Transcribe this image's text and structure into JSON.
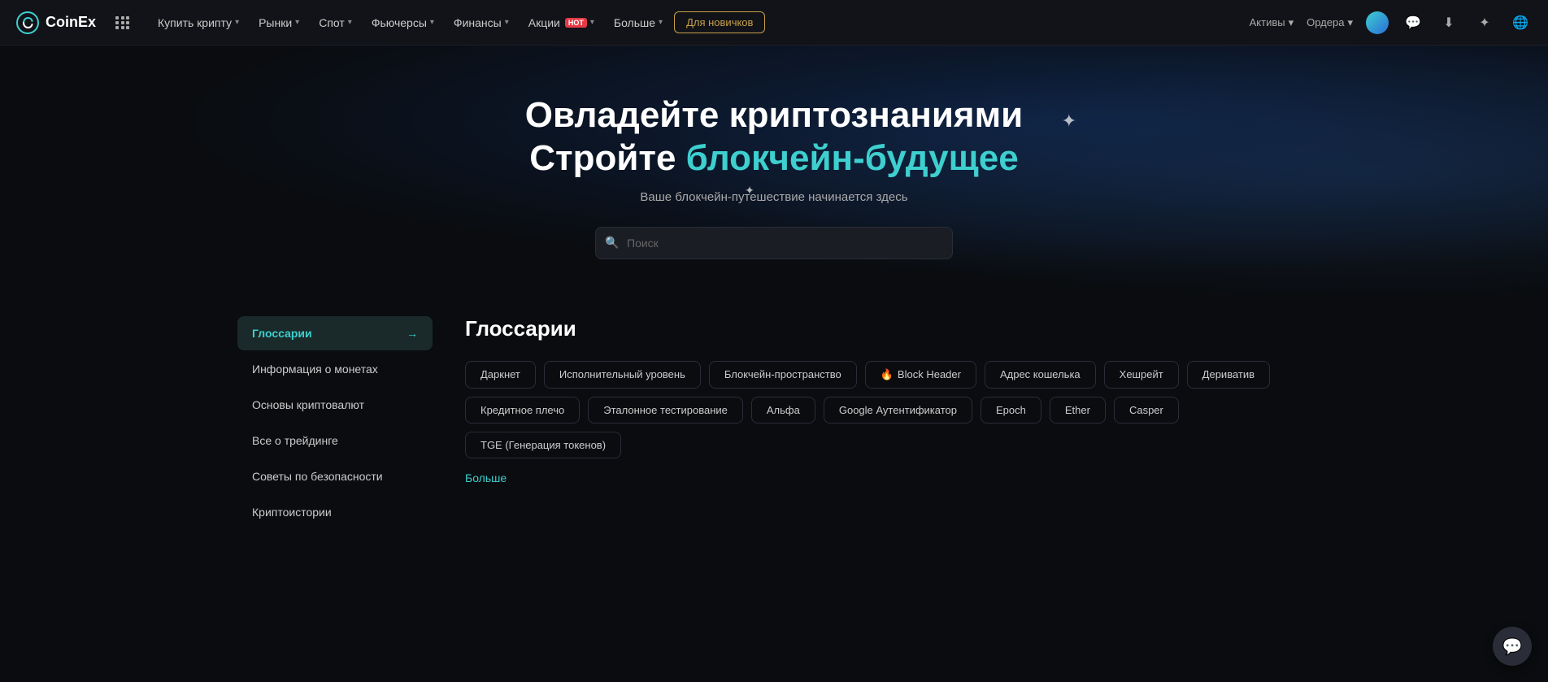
{
  "navbar": {
    "logo_text": "CoinEx",
    "items": [
      {
        "label": "Купить крипту",
        "has_dropdown": true
      },
      {
        "label": "Рынки",
        "has_dropdown": true
      },
      {
        "label": "Спот",
        "has_dropdown": true
      },
      {
        "label": "Фьючерсы",
        "has_dropdown": true
      },
      {
        "label": "Финансы",
        "has_dropdown": true
      },
      {
        "label": "Акции",
        "has_dropdown": true,
        "badge": "HOT"
      },
      {
        "label": "Больше",
        "has_dropdown": true
      }
    ],
    "novice_btn": "Для новичков",
    "right_items": [
      {
        "label": "Активы",
        "has_dropdown": true
      },
      {
        "label": "Ордера",
        "has_dropdown": true
      }
    ]
  },
  "hero": {
    "title_line1": "Овладейте криптознаниями",
    "title_line2_prefix": "Стройте ",
    "title_line2_accent": "блокчейн-будущее",
    "subtitle": "Ваше блокчейн-путешествие начинается здесь",
    "search_placeholder": "Поиск"
  },
  "sidebar": {
    "items": [
      {
        "label": "Глоссарии",
        "active": true
      },
      {
        "label": "Информация о монетах",
        "active": false
      },
      {
        "label": "Основы криптовалют",
        "active": false
      },
      {
        "label": "Все о трейдинге",
        "active": false
      },
      {
        "label": "Советы по безопасности",
        "active": false
      },
      {
        "label": "Криптоистории",
        "active": false
      }
    ]
  },
  "glossary": {
    "title": "Глоссарии",
    "tags": [
      {
        "label": "Даркнет",
        "fire": false
      },
      {
        "label": "Исполнительный уровень",
        "fire": false
      },
      {
        "label": "Блокчейн-пространство",
        "fire": false
      },
      {
        "label": "Block Header",
        "fire": true
      },
      {
        "label": "Адрес кошелька",
        "fire": false
      },
      {
        "label": "Хешрейт",
        "fire": false
      },
      {
        "label": "Дериватив",
        "fire": false
      },
      {
        "label": "Кредитное плечо",
        "fire": false
      },
      {
        "label": "Эталонное тестирование",
        "fire": false
      },
      {
        "label": "Альфа",
        "fire": false
      },
      {
        "label": "Google Аутентификатор",
        "fire": false
      },
      {
        "label": "Epoch",
        "fire": false
      },
      {
        "label": "Ether",
        "fire": false
      },
      {
        "label": "Casper",
        "fire": false
      },
      {
        "label": "TGE (Генерация токенов)",
        "fire": false
      }
    ],
    "more_label": "Больше"
  }
}
